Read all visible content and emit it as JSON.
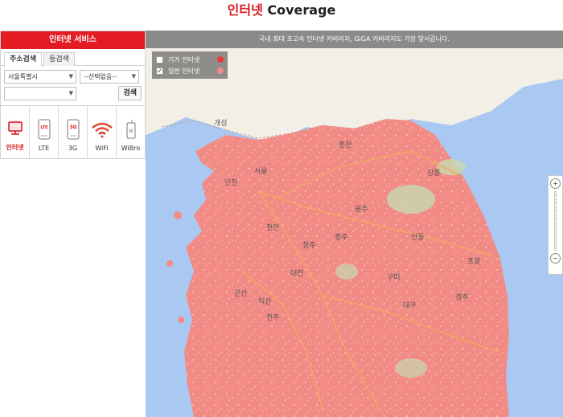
{
  "title": {
    "prefix": "인터넷",
    "suffix": " Coverage"
  },
  "panel": {
    "header": "인터넷 서비스",
    "tabs": [
      "주소검색",
      "등검색"
    ],
    "city_select": "서울특별시",
    "district_select": "--선택없음--",
    "third_select": "",
    "search_label": "검색"
  },
  "services": [
    {
      "label": "인터넷",
      "icon": "monitor-icon",
      "active": true
    },
    {
      "label": "LTE",
      "icon": "lte-phone-icon",
      "active": false
    },
    {
      "label": "3G",
      "icon": "3g-phone-icon",
      "active": false
    },
    {
      "label": "WiFi",
      "icon": "wifi-icon",
      "active": false
    },
    {
      "label": "WiBro",
      "icon": "wibro-device-icon",
      "active": false
    }
  ],
  "map": {
    "banner": "국내 최대 초고속 인터넷 커버리지, GiGA 커버리지도 가장 앞서갑니다.",
    "legend": [
      {
        "label": "기가 인터넷",
        "checked": false,
        "color": "#e83a3a"
      },
      {
        "label": "일반 인터넷",
        "checked": true,
        "color": "#f28a8a"
      }
    ],
    "cities": [
      "개성",
      "서울",
      "인천",
      "춘천",
      "강릉",
      "원주",
      "충주",
      "천안",
      "청주",
      "대전",
      "전주",
      "안동",
      "구미",
      "대구",
      "포항",
      "군산",
      "익산",
      "경주"
    ],
    "zoom_in": "+",
    "zoom_out": "−",
    "colors": {
      "coverage": "#f28b86",
      "sea": "#a9c8f2",
      "land": "#efe9da",
      "north": "#f2f0e6",
      "mountain": "#c7d9ae",
      "highway": "#f0a85e"
    }
  }
}
